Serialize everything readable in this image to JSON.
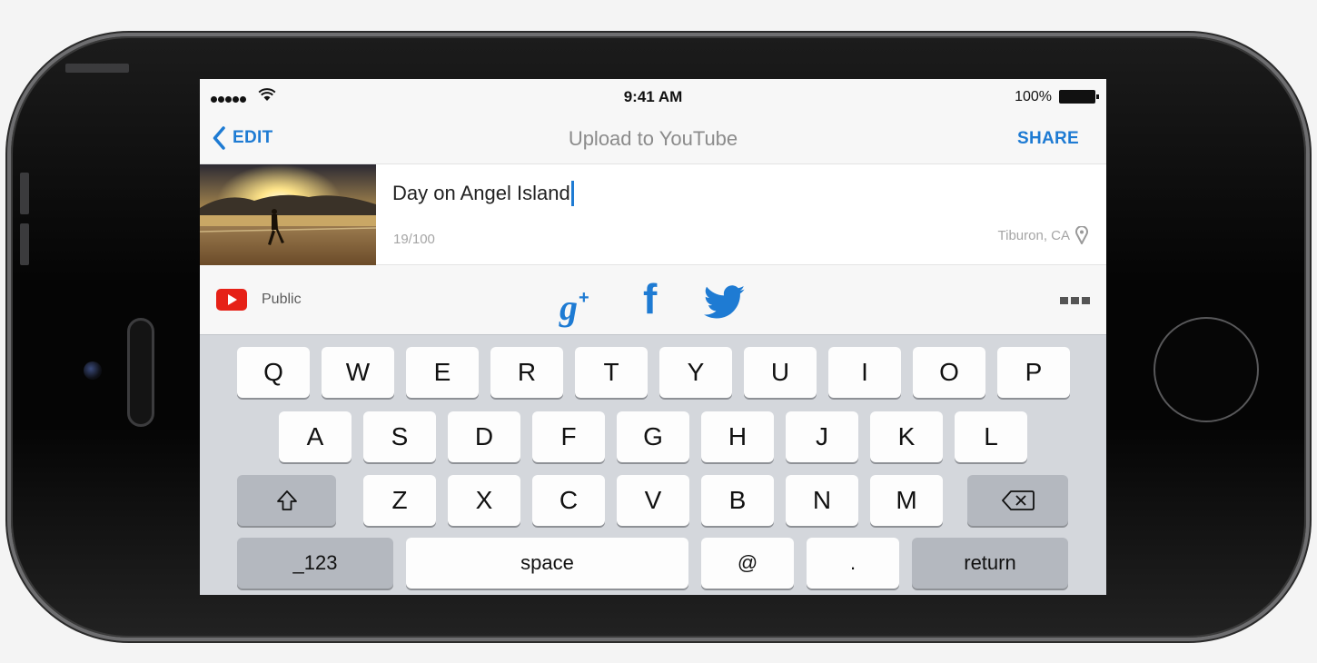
{
  "status_bar": {
    "time": "9:41 AM",
    "battery_percent": "100%",
    "signal_dots": 5
  },
  "nav": {
    "back_label": "EDIT",
    "title": "Upload to YouTube",
    "share_label": "SHARE"
  },
  "video": {
    "title_value": "Day on Angel Island",
    "char_count": "19/100",
    "location": "Tiburon, CA"
  },
  "share_row": {
    "privacy_label": "Public",
    "gplus_label": "g",
    "gplus_sup": "+",
    "facebook_label": "f"
  },
  "keyboard": {
    "row1": [
      "Q",
      "W",
      "E",
      "R",
      "T",
      "Y",
      "U",
      "I",
      "O",
      "P"
    ],
    "row2": [
      "A",
      "S",
      "D",
      "F",
      "G",
      "H",
      "J",
      "K",
      "L"
    ],
    "row3": [
      "Z",
      "X",
      "C",
      "V",
      "B",
      "N",
      "M"
    ],
    "numbers_key": "_123",
    "space_key": "space",
    "at_key": "@",
    "dot_key": ".",
    "return_key": "return"
  },
  "colors": {
    "accent": "#1e7bd3",
    "youtube_red": "#e62117",
    "keyboard_bg": "#d4d7dc"
  },
  "icons": [
    "wifi-icon",
    "battery-icon",
    "back-chevron-icon",
    "youtube-icon",
    "google-plus-icon",
    "facebook-icon",
    "twitter-icon",
    "more-icon",
    "location-pin-icon",
    "shift-icon",
    "backspace-icon"
  ]
}
